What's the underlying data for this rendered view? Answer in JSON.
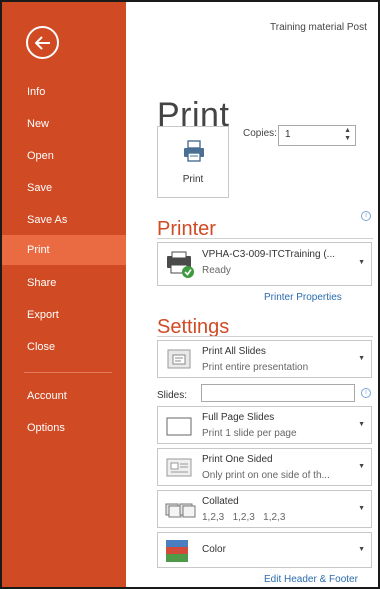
{
  "document_title": "Training material Post",
  "sidebar": {
    "items": [
      {
        "label": "Info"
      },
      {
        "label": "New"
      },
      {
        "label": "Open"
      },
      {
        "label": "Save"
      },
      {
        "label": "Save As"
      },
      {
        "label": "Print",
        "active": true
      },
      {
        "label": "Share"
      },
      {
        "label": "Export"
      },
      {
        "label": "Close"
      },
      {
        "label": "Account"
      },
      {
        "label": "Options"
      }
    ],
    "accent_color": "#d04a24",
    "active_color": "#ea6b41"
  },
  "page": {
    "heading": "Print"
  },
  "print_button": {
    "label": "Print"
  },
  "copies": {
    "label": "Copies:",
    "value": "1"
  },
  "printer": {
    "heading": "Printer",
    "name": "VPHA-C3-009-ITCTraining (...",
    "status": "Ready",
    "properties_link": "Printer Properties"
  },
  "settings": {
    "heading": "Settings",
    "print_range": {
      "title": "Print All Slides",
      "subtitle": "Print entire presentation"
    },
    "slides_label": "Slides:",
    "layout": {
      "title": "Full Page Slides",
      "subtitle": "Print 1 slide per page"
    },
    "sides": {
      "title": "Print One Sided",
      "subtitle": "Only print on one side of th..."
    },
    "collation": {
      "title": "Collated",
      "subtitle": "1,2,3   1,2,3   1,2,3"
    },
    "color": {
      "title": "Color"
    },
    "edit_header_footer_link": "Edit Header & Footer"
  }
}
